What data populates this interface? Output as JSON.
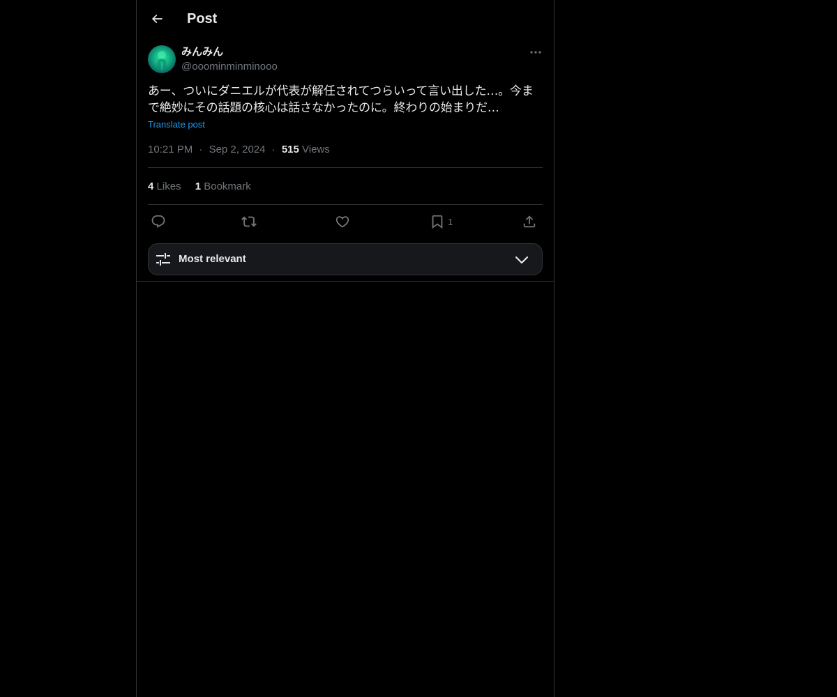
{
  "header": {
    "title": "Post",
    "back_icon": "arrow-left-icon"
  },
  "author": {
    "display_name": "みんみん",
    "handle": "@ooominminminooo",
    "avatar_icon": "avatar-image"
  },
  "post": {
    "text_line1": "あー、ついにダニエルが代表が解任されてつらいって言い出した…。今ま",
    "text_line2": "で絶妙にその話題の核心は話さなかったのに。終わりの始まりだ…",
    "translate_label": "Translate post",
    "time": "10:21 PM",
    "separator": "·",
    "date": "Sep 2, 2024",
    "views_count": "515",
    "views_label": "Views"
  },
  "stats": {
    "likes_count": "4",
    "likes_label": "Likes",
    "bookmarks_count": "1",
    "bookmarks_label": "Bookmark"
  },
  "actions": {
    "reply_icon": "reply-icon",
    "repost_icon": "repost-icon",
    "like_icon": "heart-icon",
    "bookmark_icon": "bookmark-icon",
    "bookmark_count": "1",
    "share_icon": "share-icon"
  },
  "sort": {
    "label": "Most relevant",
    "icon": "sliders-icon",
    "chevron": "chevron-down-icon"
  },
  "colors": {
    "background": "#000000",
    "text_primary": "#e7e9ea",
    "text_secondary": "#71767b",
    "link": "#1d9bf0",
    "border": "#2f3336",
    "sort_bar_bg": "#16181c"
  }
}
